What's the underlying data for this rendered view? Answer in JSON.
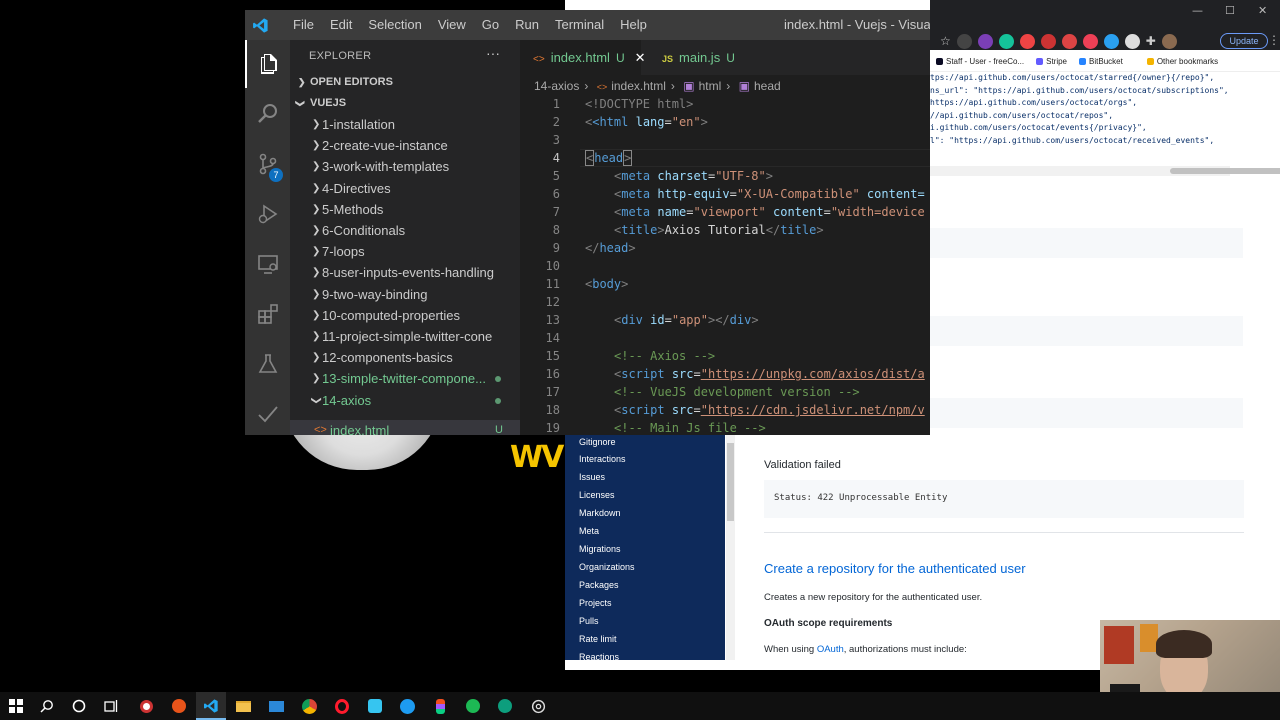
{
  "browser": {
    "window_controls": [
      "—",
      "☐",
      "✕"
    ],
    "update_label": "Update",
    "bookmarks": [
      "Staff - User - freeCo...",
      "Stripe",
      "BitBucket",
      "Other bookmarks"
    ],
    "json_lines": [
      "tps://api.github.com/users/octocat/starred{/owner}{/repo}\",",
      "ns_url\": \"https://api.github.com/users/octocat/subscriptions\",",
      "https://api.github.com/users/octocat/orgs\",",
      "//api.github.com/users/octocat/repos\",",
      "i.github.com/users/octocat/events{/privacy}\",",
      "l\": \"https://api.github.com/users/octocat/received_events\","
    ],
    "doc_sidebar_links": [
      "Gitignore",
      "Interactions",
      "Issues",
      "Licenses",
      "Markdown",
      "Meta",
      "Migrations",
      "Organizations",
      "Packages",
      "Projects",
      "Pulls",
      "Rate limit",
      "Reactions"
    ],
    "validation_title": "Validation failed",
    "status_text": "Status: 422 Unprocessable Entity",
    "create_heading": "Create a repository for the authenticated user",
    "create_desc": "Creates a new repository for the authenticated user.",
    "oauth_heading": "OAuth scope requirements",
    "when_using_prefix": "When using ",
    "when_using_link": "OAuth",
    "when_using_suffix": ", authorizations must include:"
  },
  "overlay_text": "WV",
  "vscode": {
    "menu": [
      "File",
      "Edit",
      "Selection",
      "View",
      "Go",
      "Run",
      "Terminal",
      "Help"
    ],
    "window_title": "index.html - Vuejs - Visual St",
    "explorer_title": "EXPLORER",
    "more_actions": "···",
    "open_editors": "OPEN EDITORS",
    "workspace": "VUEJS",
    "scm_badge": "7",
    "folders": [
      {
        "name": "1-installation",
        "untracked": false
      },
      {
        "name": "2-create-vue-instance",
        "untracked": false
      },
      {
        "name": "3-work-with-templates",
        "untracked": false
      },
      {
        "name": "4-Directives",
        "untracked": false
      },
      {
        "name": "5-Methods",
        "untracked": false
      },
      {
        "name": "6-Conditionals",
        "untracked": false
      },
      {
        "name": "7-loops",
        "untracked": false
      },
      {
        "name": "8-user-inputs-events-handling",
        "untracked": false
      },
      {
        "name": "9-two-way-binding",
        "untracked": false
      },
      {
        "name": "10-computed-properties",
        "untracked": false
      },
      {
        "name": "11-project-simple-twitter-cone",
        "untracked": false
      },
      {
        "name": "12-components-basics",
        "untracked": false
      },
      {
        "name": "13-simple-twitter-compone...",
        "untracked": true
      },
      {
        "name": "14-axios",
        "untracked": true
      }
    ],
    "open_file": {
      "name": "index.html",
      "status": "U"
    },
    "tabs": [
      {
        "name": "index.html",
        "status": "U",
        "close": "✕"
      },
      {
        "name": "main.js",
        "status": "U",
        "icon": "JS"
      }
    ],
    "breadcrumb": [
      "14-axios",
      "index.html",
      "html",
      "head"
    ],
    "line_numbers": [
      "1",
      "2",
      "3",
      "4",
      "5",
      "6",
      "7",
      "8",
      "9",
      "10",
      "11",
      "12",
      "13",
      "14",
      "15",
      "16",
      "17",
      "18",
      "19"
    ],
    "current_line": "4",
    "code": {
      "l1_doctype": "<!DOCTYPE html>",
      "l2_html_open": "<html",
      "l2_attr": "lang",
      "l2_val": "\"en\"",
      "l4_head": "head",
      "l5_meta": "meta",
      "l5_attr": "charset",
      "l5_val": "\"UTF-8\"",
      "l6_attr": "http-equiv",
      "l6_val": "\"X-UA-Compatible\"",
      "l6_attr2": "content=",
      "l7_attr": "name",
      "l7_val": "\"viewport\"",
      "l7_attr2": "content",
      "l7_val2": "\"width=device",
      "l8_title": "title",
      "l8_text": "Axios Tutorial",
      "l9_head_close": "head",
      "l11_body": "body",
      "l13_div": "div",
      "l13_attr": "id",
      "l13_val": "\"app\"",
      "l15_comment": "<!-- Axios -->",
      "l16_script": "script",
      "l16_attr": "src",
      "l16_url": "\"https://unpkg.com/axios/dist/a",
      "l17_comment": "<!-- VueJS development version -->",
      "l18_url": "\"https://cdn.jsdelivr.net/npm/v",
      "l19_comment": "<!-- Main Js file -->"
    }
  }
}
